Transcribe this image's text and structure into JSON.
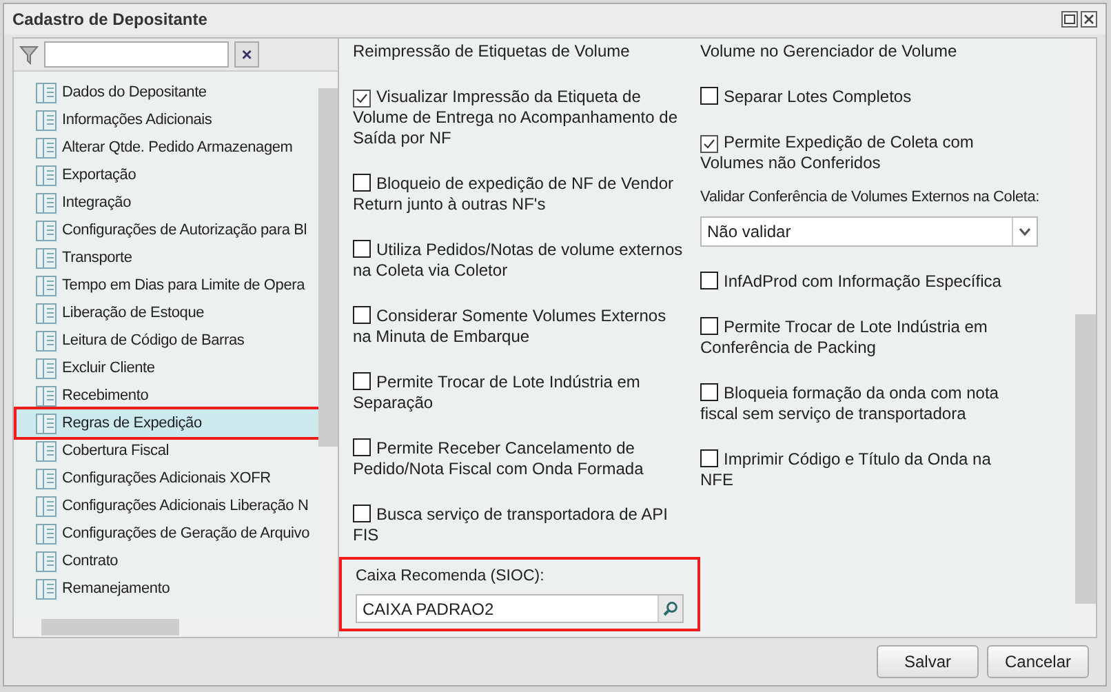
{
  "window": {
    "title": "Cadastro de Depositante"
  },
  "sidebar": {
    "clear_label": "×",
    "items": [
      {
        "label": "Dados do Depositante",
        "selected": false
      },
      {
        "label": "Informações Adicionais",
        "selected": false
      },
      {
        "label": "Alterar Qtde. Pedido Armazenagem",
        "selected": false
      },
      {
        "label": "Exportação",
        "selected": false
      },
      {
        "label": "Integração",
        "selected": false
      },
      {
        "label": "Configurações de Autorização para Bl",
        "selected": false
      },
      {
        "label": "Transporte",
        "selected": false
      },
      {
        "label": "Tempo em Dias para Limite de Opera",
        "selected": false
      },
      {
        "label": "Liberação de Estoque",
        "selected": false
      },
      {
        "label": "Leitura de Código de Barras",
        "selected": false
      },
      {
        "label": "Excluir Cliente",
        "selected": false
      },
      {
        "label": "Recebimento",
        "selected": false
      },
      {
        "label": "Regras de Expedição",
        "selected": true
      },
      {
        "label": "Cobertura Fiscal",
        "selected": false
      },
      {
        "label": "Configurações Adicionais XOFR",
        "selected": false
      },
      {
        "label": "Configurações Adicionais Liberação N",
        "selected": false
      },
      {
        "label": "Configurações de Geração de Arquivo",
        "selected": false
      },
      {
        "label": "Contrato",
        "selected": false
      },
      {
        "label": "Remanejamento",
        "selected": false
      }
    ]
  },
  "left_column": [
    {
      "kind": "continuation",
      "label": "Reimpressão de Etiquetas de Volume"
    },
    {
      "kind": "checkbox",
      "label": "Visualizar Impressão da Etiqueta de Volume de Entrega no Acompanhamento de Saída por NF",
      "checked": true
    },
    {
      "kind": "checkbox",
      "label": "Bloqueio de expedição de NF de Vendor Return junto à outras NF's",
      "checked": false
    },
    {
      "kind": "checkbox",
      "label": "Utiliza Pedidos/Notas de volume externos na Coleta via Coletor",
      "checked": false
    },
    {
      "kind": "checkbox",
      "label": "Considerar Somente Volumes Externos na Minuta de Embarque",
      "checked": false
    },
    {
      "kind": "checkbox",
      "label": "Permite Trocar de Lote Indústria em Separação",
      "checked": false
    },
    {
      "kind": "checkbox",
      "label": "Permite Receber Cancelamento de Pedido/Nota Fiscal com Onda Formada",
      "checked": false
    },
    {
      "kind": "checkbox",
      "label": "Busca serviço de transportadora de API FIS",
      "checked": false
    }
  ],
  "caixa": {
    "label": "Caixa Recomenda (SIOC):",
    "value": "CAIXA PADRAO2"
  },
  "right_column": [
    {
      "kind": "continuation",
      "label": "Volume no Gerenciador de Volume"
    },
    {
      "kind": "checkbox",
      "label": "Separar Lotes Completos",
      "checked": false
    },
    {
      "kind": "checkbox",
      "label": "Permite Expedição de Coleta com Volumes não Conferidos",
      "checked": true
    },
    {
      "kind": "dropdown",
      "label": "Validar Conferência de Volumes Externos na Coleta:",
      "value": "Não validar"
    },
    {
      "kind": "checkbox",
      "label": "InfAdProd com Informação Específica",
      "checked": false
    },
    {
      "kind": "checkbox",
      "label": "Permite Trocar de Lote Indústria em Conferência de Packing",
      "checked": false
    },
    {
      "kind": "checkbox",
      "label": "Bloqueia formação da onda com nota fiscal sem serviço de transportadora",
      "checked": false
    },
    {
      "kind": "checkbox",
      "label": "Imprimir Código e Título da Onda na NFE",
      "checked": false
    }
  ],
  "buttons": [
    "Salvar",
    "Cancelar"
  ]
}
